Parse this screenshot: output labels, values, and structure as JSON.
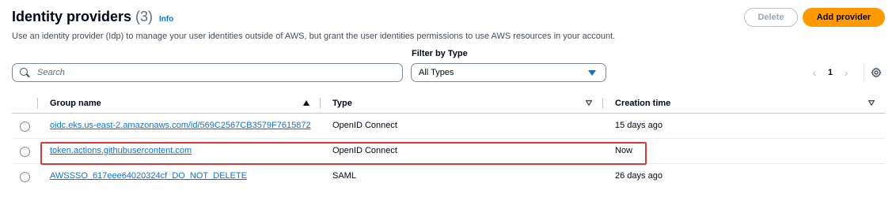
{
  "header": {
    "title": "Identity providers",
    "count": "(3)",
    "info_link": "Info",
    "description": "Use an identity provider (Idp) to manage your user identities outside of AWS, but grant the user identities permissions to use AWS resources in your account."
  },
  "actions": {
    "delete_label": "Delete",
    "add_label": "Add provider"
  },
  "filter": {
    "label": "Filter by Type",
    "selected": "All Types"
  },
  "search": {
    "placeholder": "Search"
  },
  "pagination": {
    "current_page": "1"
  },
  "table": {
    "columns": {
      "name": "Group name",
      "type": "Type",
      "created": "Creation time"
    },
    "rows": [
      {
        "name": "oidc.eks.us-east-2.amazonaws.com/id/569C2567CB3579F7615872",
        "type": "OpenID Connect",
        "created": "15 days ago"
      },
      {
        "name": "token.actions.githubusercontent.com",
        "type": "OpenID Connect",
        "created": "Now"
      },
      {
        "name": "AWSSSO_617eee64020324cf_DO_NOT_DELETE",
        "type": "SAML",
        "created": "26 days ago"
      }
    ]
  },
  "colors": {
    "accent": "#ff9900",
    "link": "#0972d3",
    "highlight": "#d13c3c"
  },
  "icons": [
    "search-icon",
    "caret-down-icon",
    "chevron-left-icon",
    "chevron-right-icon",
    "gear-icon",
    "sort-ascending-icon",
    "sort-icon"
  ]
}
